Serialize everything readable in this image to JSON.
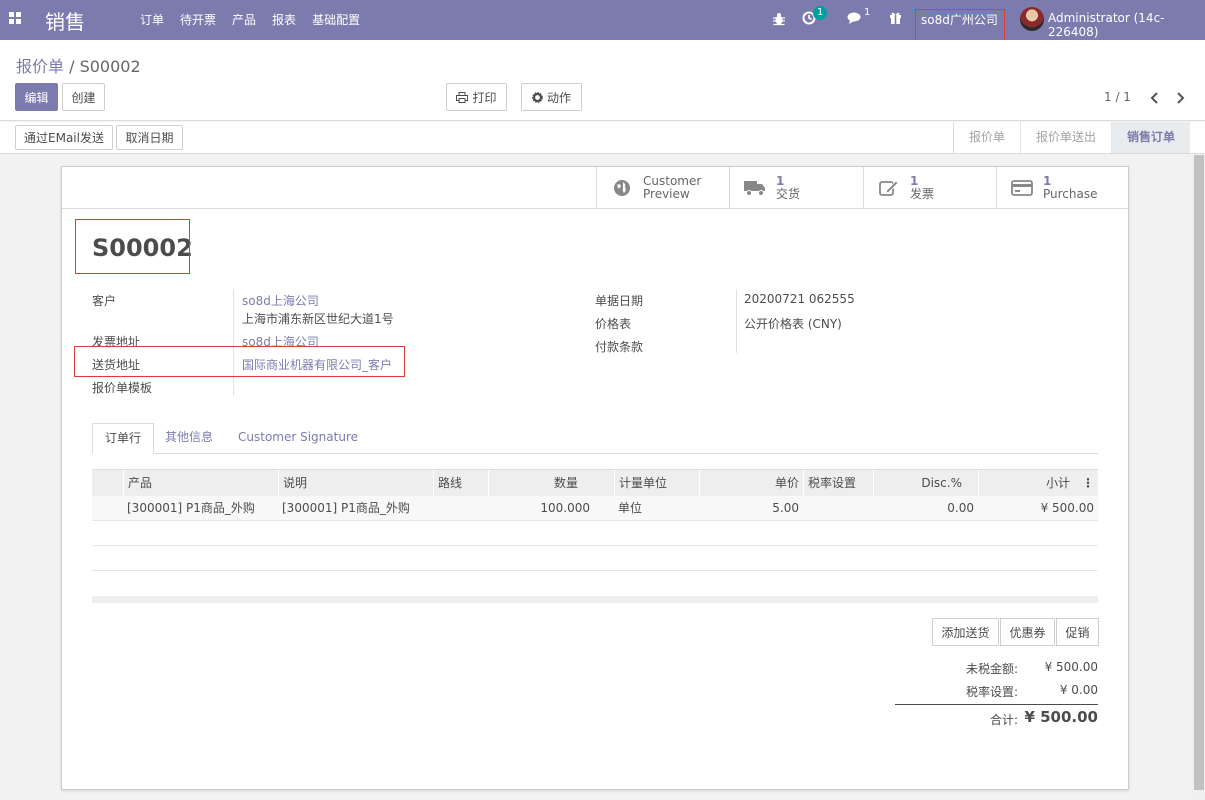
{
  "navbar": {
    "brand": "销售",
    "menu": [
      "订单",
      "待开票",
      "产品",
      "报表",
      "基础配置"
    ],
    "activity_count": "1",
    "message_count": "1",
    "company": "so8d广州公司",
    "user": "Administrator (14c-226408)"
  },
  "control": {
    "breadcrumb_parent": "报价单",
    "breadcrumb_sep": "/",
    "breadcrumb_current": "S00002",
    "edit_label": "编辑",
    "create_label": "创建",
    "print_label": "打印",
    "action_label": "动作",
    "pager": "1 / 1"
  },
  "statusbar": {
    "send_email_label": "通过EMail发送",
    "cancel_label": "取消日期",
    "steps": [
      "报价单",
      "报价单送出",
      "销售订单"
    ],
    "active_step": "销售订单"
  },
  "smart_buttons": [
    {
      "count": "",
      "label": "Customer",
      "label2": "Preview",
      "icon": "globe-icon"
    },
    {
      "count": "1",
      "label": "交货",
      "icon": "truck-icon"
    },
    {
      "count": "1",
      "label": "发票",
      "icon": "edit-icon"
    },
    {
      "count": "1",
      "label": "Purchase",
      "icon": "credit-card-icon"
    }
  ],
  "form": {
    "name": "S00002",
    "customer_label": "客户",
    "customer": "so8d上海公司",
    "customer_address": "上海市浦东新区世纪大道1号",
    "invoice_address_label": "发票地址",
    "invoice_address": "so8d上海公司",
    "delivery_address_label": "送货地址",
    "delivery_address": "国际商业机器有限公司_客户",
    "template_label": "报价单模板",
    "date_label": "单据日期",
    "date": "20200721 062555",
    "pricelist_label": "价格表",
    "pricelist": "公开价格表 (CNY)",
    "payment_terms_label": "付款条款"
  },
  "tabs": [
    "订单行",
    "其他信息",
    "Customer Signature"
  ],
  "table": {
    "headers": [
      "产品",
      "说明",
      "路线",
      "数量",
      "计量单位",
      "单价",
      "税率设置",
      "Disc.%",
      "小计"
    ],
    "rows": [
      {
        "product": "[300001] P1商品_外购",
        "description": "[300001] P1商品_外购",
        "route": "",
        "qty": "100.000",
        "uom": "单位",
        "price": "5.00",
        "tax": "",
        "disc": "0.00",
        "subtotal": "¥ 500.00"
      }
    ]
  },
  "sale_buttons": [
    "添加送货",
    "优惠券",
    "促销"
  ],
  "totals": {
    "untaxed_label": "未税金额:",
    "untaxed": "¥ 500.00",
    "tax_label": "税率设置:",
    "tax": "¥ 0.00",
    "total_label": "合计:",
    "total": "¥ 500.00"
  },
  "colors": {
    "brand": "#7c7bad",
    "badge": "#00a09d",
    "highlight_box": "#e03a3a"
  }
}
